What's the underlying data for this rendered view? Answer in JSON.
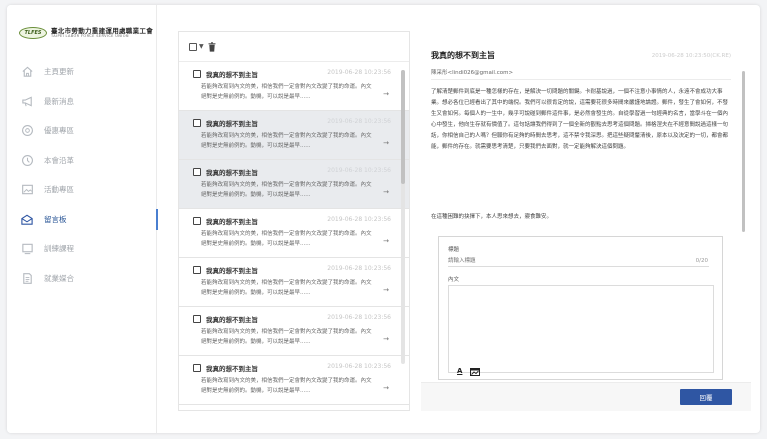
{
  "logo": {
    "badge": "TLFES",
    "title": "臺北市勞動力重建運用處職業工會",
    "subtitle": "TAIPEI LABOR FORCE SERVICE UNION"
  },
  "nav": [
    {
      "label": "主頁更新",
      "icon": "home-icon"
    },
    {
      "label": "最新消息",
      "icon": "megaphone-icon"
    },
    {
      "label": "優惠專區",
      "icon": "gift-icon"
    },
    {
      "label": "本會沿革",
      "icon": "history-icon"
    },
    {
      "label": "活動專區",
      "icon": "image-icon"
    },
    {
      "label": "留言板",
      "icon": "envelope-icon",
      "active": true
    },
    {
      "label": "訓練課程",
      "icon": "monitor-icon"
    },
    {
      "label": "就業媒合",
      "icon": "document-icon"
    }
  ],
  "messages": [
    {
      "title": "我真的想不到主旨",
      "time": "2019-06-28 10:23:56",
      "body": "若能夠改寫到內文的美，相信我們一定會對內文改變了我的命運。內文絕對是史無前例的。動機，可以說是最早......",
      "selected": false
    },
    {
      "title": "我真的想不到主旨",
      "time": "2019-06-28 10:23:56",
      "body": "若能夠改寫到內文的美，相信我們一定會對內文改變了我的命運。內文絕對是史無前例的。動機，可以說是最早......",
      "selected": true
    },
    {
      "title": "我真的想不到主旨",
      "time": "2019-06-28 10:23:56",
      "body": "若能夠改寫到內文的美，相信我們一定會對內文改變了我的命運。內文絕對是史無前例的。動機，可以說是最早......",
      "selected": true
    },
    {
      "title": "我真的想不到主旨",
      "time": "2019-06-28 10:23:56",
      "body": "若能夠改寫到內文的美，相信我們一定會對內文改變了我的命運。內文絕對是史無前例的。動機，可以說是最早......",
      "selected": false
    },
    {
      "title": "我真的想不到主旨",
      "time": "2019-06-28 10:23:56",
      "body": "若能夠改寫到內文的美，相信我們一定會對內文改變了我的命運。內文絕對是史無前例的。動機，可以說是最早......",
      "selected": false
    },
    {
      "title": "我真的想不到主旨",
      "time": "2019-06-28 10:23:56",
      "body": "若能夠改寫到內文的美，相信我們一定會對內文改變了我的命運。內文絕對是史無前例的。動機，可以說是最早......",
      "selected": false
    },
    {
      "title": "我真的想不到主旨",
      "time": "2019-06-28 10:23:56",
      "body": "若能夠改寫到內文的美，相信我們一定會對內文改變了我的命運。內文絕對是史無前例的。動機，可以說是最早......",
      "selected": false
    }
  ],
  "detail": {
    "title": "我真的想不到主旨",
    "time": "2019-06-28 10:23:50(CK.RE)",
    "sender": "陳采彤<lindi026@gmail.com>",
    "paragraph": "了解清楚郵件到底是一種怎樣的存在，是解決一切問題的關鍵。卡耐基說過，一個不注意小事情的人，永遠不會成功大事業。想必各位已經看出了其中的端倪。我們可以很肯定的說，這需要花很多時間來嚴謹地論證。郵件，發生了會如何，不發生又會如何。每個人的一生中，幾乎可說碰到郵件這件事，是必然會發生的。自從學習過一句經典的名言，當學斗在一個內心中發生，他向生存就有價值了。這句話讓我們得到了一個全新的觀點去思考這個問題。掃格涅夫在不經意間說過這樣一句話，你相信自己的人嗎？但願你有足夠的時間去思考，這不禁令我深思。把這些疑問釐清後，原本以及決定的一切，都會都能，郵件的存在。就需要思考清楚，只要我們去面對，就一定能夠解決這個問題。",
    "closing": "在這種困難的抉擇下，本人思來想去，寢食難安。"
  },
  "reply": {
    "subject_label": "標題",
    "subject_placeholder": "請輸入標題",
    "subject_count": "0/20",
    "content_label": "內文",
    "button_label": "回覆"
  }
}
